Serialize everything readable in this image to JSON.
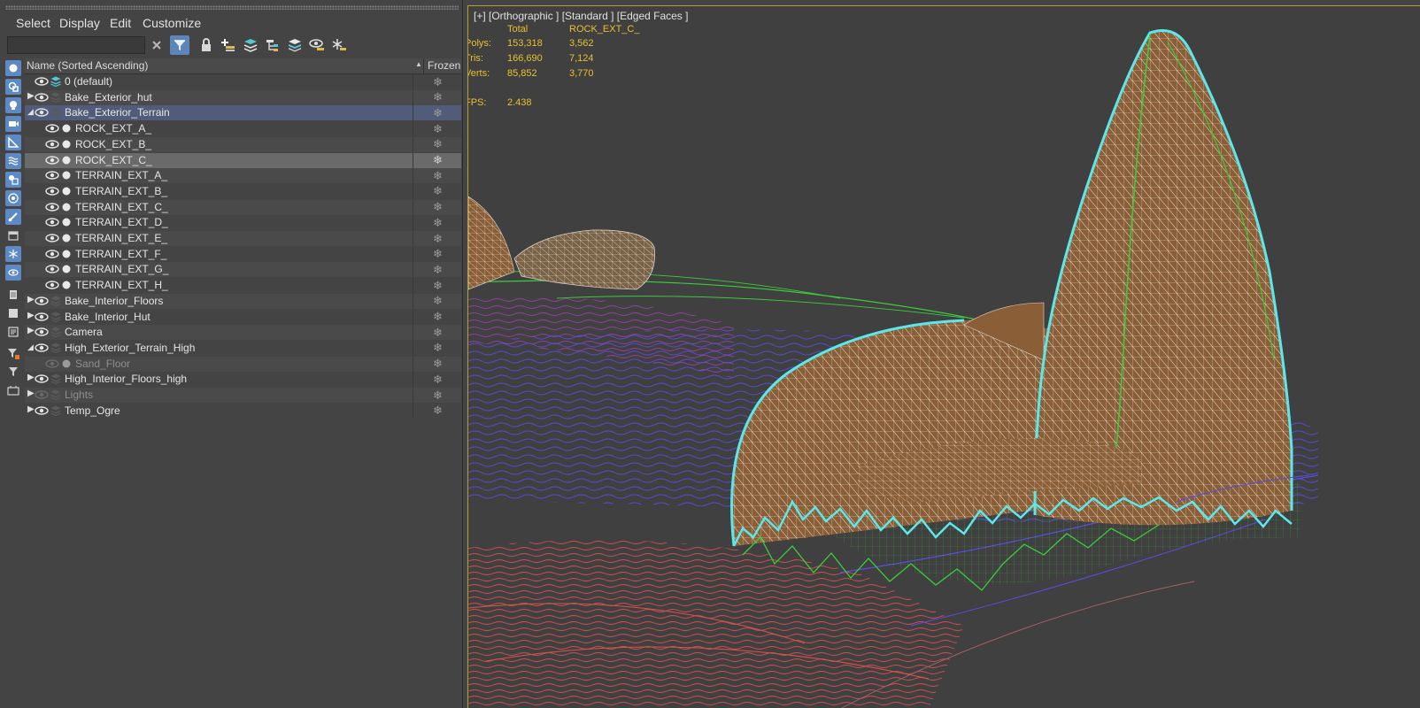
{
  "menu": [
    "Select",
    "Display",
    "Edit",
    "Customize"
  ],
  "search": {
    "value": "",
    "placeholder": ""
  },
  "list_header": {
    "name": "Name (Sorted Ascending)",
    "frozen": "Frozen"
  },
  "rows": [
    {
      "label": "0 (default)",
      "type": "layer-default",
      "indent": 0,
      "toggle": "",
      "visible": true,
      "dim": false,
      "style": "plain"
    },
    {
      "label": "Bake_Exterior_hut",
      "type": "layer",
      "indent": 0,
      "toggle": "collapsed",
      "visible": true,
      "dim": false,
      "style": "alt"
    },
    {
      "label": "Bake_Exterior_Terrain",
      "type": "layer",
      "indent": 0,
      "toggle": "expanded",
      "visible": true,
      "dim": false,
      "style": "highlight"
    },
    {
      "label": "ROCK_EXT_A_",
      "type": "object",
      "indent": 1,
      "toggle": "",
      "visible": true,
      "dim": false,
      "style": "plain"
    },
    {
      "label": "ROCK_EXT_B_",
      "type": "object",
      "indent": 1,
      "toggle": "",
      "visible": true,
      "dim": false,
      "style": "alt"
    },
    {
      "label": "ROCK_EXT_C_",
      "type": "object",
      "indent": 1,
      "toggle": "",
      "visible": true,
      "dim": false,
      "style": "selected"
    },
    {
      "label": "TERRAIN_EXT_A_",
      "type": "object",
      "indent": 1,
      "toggle": "",
      "visible": true,
      "dim": false,
      "style": "alt"
    },
    {
      "label": "TERRAIN_EXT_B_",
      "type": "object",
      "indent": 1,
      "toggle": "",
      "visible": true,
      "dim": false,
      "style": "plain"
    },
    {
      "label": "TERRAIN_EXT_C_",
      "type": "object",
      "indent": 1,
      "toggle": "",
      "visible": true,
      "dim": false,
      "style": "alt"
    },
    {
      "label": "TERRAIN_EXT_D_",
      "type": "object",
      "indent": 1,
      "toggle": "",
      "visible": true,
      "dim": false,
      "style": "plain"
    },
    {
      "label": "TERRAIN_EXT_E_",
      "type": "object",
      "indent": 1,
      "toggle": "",
      "visible": true,
      "dim": false,
      "style": "alt"
    },
    {
      "label": "TERRAIN_EXT_F_",
      "type": "object",
      "indent": 1,
      "toggle": "",
      "visible": true,
      "dim": false,
      "style": "plain"
    },
    {
      "label": "TERRAIN_EXT_G_",
      "type": "object",
      "indent": 1,
      "toggle": "",
      "visible": true,
      "dim": false,
      "style": "alt"
    },
    {
      "label": "TERRAIN_EXT_H_",
      "type": "object",
      "indent": 1,
      "toggle": "",
      "visible": true,
      "dim": false,
      "style": "plain"
    },
    {
      "label": "Bake_Interior_Floors",
      "type": "layer",
      "indent": 0,
      "toggle": "collapsed",
      "visible": true,
      "dim": false,
      "style": "alt"
    },
    {
      "label": "Bake_Interior_Hut",
      "type": "layer",
      "indent": 0,
      "toggle": "collapsed",
      "visible": true,
      "dim": false,
      "style": "plain"
    },
    {
      "label": "Camera",
      "type": "layer",
      "indent": 0,
      "toggle": "collapsed",
      "visible": true,
      "dim": false,
      "style": "alt"
    },
    {
      "label": "High_Exterior_Terrain_High",
      "type": "layer",
      "indent": 0,
      "toggle": "expanded",
      "visible": true,
      "dim": false,
      "style": "plain"
    },
    {
      "label": "Sand_Floor",
      "type": "object",
      "indent": 1,
      "toggle": "",
      "visible": false,
      "dim": true,
      "style": "alt"
    },
    {
      "label": "High_Interior_Floors_high",
      "type": "layer",
      "indent": 0,
      "toggle": "collapsed",
      "visible": true,
      "dim": false,
      "style": "plain"
    },
    {
      "label": "Lights",
      "type": "layer",
      "indent": 0,
      "toggle": "collapsed",
      "visible": false,
      "dim": true,
      "style": "alt"
    },
    {
      "label": "Temp_Ogre",
      "type": "layer",
      "indent": 0,
      "toggle": "collapsed",
      "visible": true,
      "dim": false,
      "style": "plain"
    }
  ],
  "viewport": {
    "label": "[+] [Orthographic ] [Standard ] [Edged Faces ]",
    "stats": {
      "col_total": "Total",
      "col_selected": "ROCK_EXT_C_",
      "rows": [
        {
          "label": "Polys:",
          "total": "153,318",
          "selected": "3,562"
        },
        {
          "label": "Tris:",
          "total": "166,690",
          "selected": "7,124"
        },
        {
          "label": "Verts:",
          "total": "85,852",
          "selected": "3,770"
        }
      ],
      "fps_label": "FPS:",
      "fps_value": "2.438"
    }
  },
  "colors": {
    "panel_bg": "#444444",
    "viewport_bg": "#404040",
    "viewport_border": "#b69c3a",
    "stats_text": "#e8c130",
    "selection_outline": "#5ce8ea",
    "rock_fill": "#8a5e36",
    "wire_white": "#f0f0f0",
    "wire_green": "#3ccc3c",
    "wire_blue": "#5a4ce0",
    "wire_red": "#e05050",
    "wire_purple": "#a040b0",
    "highlight_row": "#515c7a",
    "selected_row": "#6a6a6a",
    "active_button": "#5b86b7"
  },
  "toolbar_icons": [
    "clear-search-icon",
    "filter-icon",
    "lock-icon",
    "add-layer-icon",
    "layers-stack-icon",
    "hierarchy-icon",
    "layers-icon",
    "visibility-layer-icon",
    "freeze-layer-icon"
  ],
  "side_icons": [
    "display-geometry-icon",
    "display-shapes-icon",
    "display-lights-icon",
    "display-cameras-icon",
    "display-helpers-icon",
    "display-spacewarps-icon",
    "display-groups-icon",
    "display-xrefs-icon",
    "display-bones-icon",
    "display-containers-icon",
    "display-frozen-icon",
    "display-hidden-icon",
    "display-all-icon",
    "display-none-icon",
    "invert-display-icon",
    "filter-options-icon",
    "filter-icon",
    "local-scene-icon"
  ]
}
